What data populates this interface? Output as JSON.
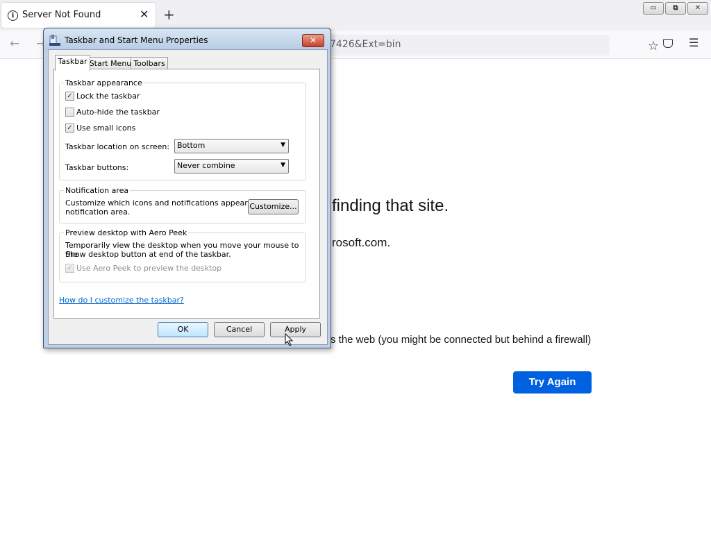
{
  "browser": {
    "tab": {
      "title": "Server Not Found",
      "close": "✕",
      "info_icon": "i"
    },
    "new_tab": "+",
    "window_controls": {
      "minimize": "▭",
      "restore": "⧉",
      "close": "✕"
    },
    "nav": {
      "back": "←",
      "forward": "→"
    },
    "url_visible": "7426&Ext=bin",
    "icons": {
      "bookmark": "star-icon",
      "pocket": "pocket-icon",
      "menu": "hamburger-menu-icon"
    }
  },
  "error_page": {
    "heading_fragment": "finding that site.",
    "line_fragment": "rosoft.com.",
    "bullet_fragment": "s the web (you might be connected but behind a firewall)",
    "try_again": "Try Again",
    "accent_color": "#0061e0"
  },
  "dialog": {
    "title": "Taskbar and Start Menu Properties",
    "close": "✕",
    "tabs": [
      "Taskbar",
      "Start Menu",
      "Toolbars"
    ],
    "active_tab": "Taskbar",
    "appearance": {
      "title": "Taskbar appearance",
      "lock": {
        "label": "Lock the taskbar",
        "checked": true
      },
      "autohide": {
        "label": "Auto-hide the taskbar",
        "checked": false
      },
      "small_icons": {
        "label": "Use small icons",
        "checked": true
      },
      "location_label": "Taskbar location on screen:",
      "location_value": "Bottom",
      "buttons_label": "Taskbar buttons:",
      "buttons_value": "Never combine"
    },
    "notification": {
      "title": "Notification area",
      "desc_line1": "Customize which icons and notifications appear in the",
      "desc_line2": "notification area.",
      "customize": "Customize..."
    },
    "aero_peek": {
      "title": "Preview desktop with Aero Peek",
      "desc_line1": "Temporarily view the desktop when you move your mouse to the",
      "desc_line2": "Show desktop button at end of the taskbar.",
      "checkbox": {
        "label": "Use Aero Peek to preview the desktop",
        "checked": true,
        "enabled": false
      }
    },
    "help_link": "How do I customize the taskbar?",
    "buttons": {
      "ok": "OK",
      "cancel": "Cancel",
      "apply": "Apply"
    },
    "check_glyph": "✓",
    "dropdown_arrow": "▼"
  }
}
